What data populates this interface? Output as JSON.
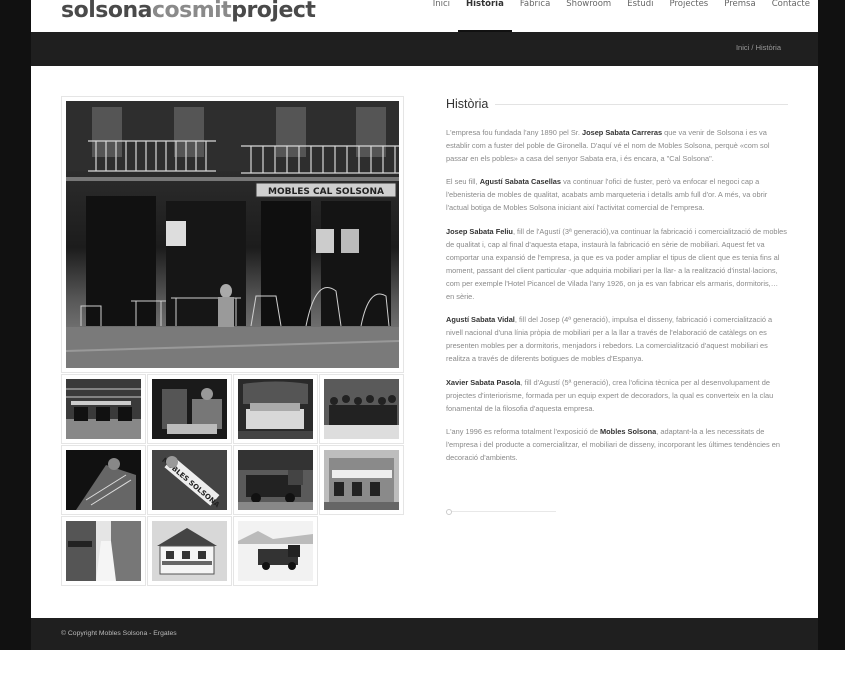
{
  "header": {
    "logo_part1": "solsona",
    "logo_part2": "cosmit",
    "logo_part3": "project",
    "nav": [
      "Inici",
      "Història",
      "Fàbrica",
      "Showroom",
      "Estudi",
      "Projectes",
      "Premsa",
      "Contacte"
    ],
    "active_nav": "Història"
  },
  "breadcrumb": {
    "home": "Inici",
    "separator": "/",
    "current": "Història"
  },
  "content": {
    "title": "Història",
    "paragraphs": [
      [
        {
          "t": "L'empresa fou fundada l'any 1890 pel Sr. "
        },
        {
          "b": "Josep Sabata Carreras"
        },
        {
          "t": " que va venir de Solsona i es va establir com a fuster del poble de Gironella. D'aquí vé el nom de Mobles Solsona, perquè «com sol passar en els pobles» a casa del senyor Sabata era, i és encara, a \"Cal Solsona\"."
        }
      ],
      [
        {
          "t": "El seu fill, "
        },
        {
          "b": "Agustí Sabata Casellas"
        },
        {
          "t": " va continuar l'ofici de fuster, però va enfocar el negoci cap a l'ebenisteria de mobles de qualitat, acabats amb marqueteria i detalls amb full d'or. A més, va obrir l'actual botiga de Mobles Solsona iniciant així l'activitat comercial de l'empresa."
        }
      ],
      [
        {
          "b": "Josep Sabata Feliu"
        },
        {
          "t": ", fill de l'Agustí (3ª generació),va continuar la fabricació i comercialització de mobles de qualitat i, cap al final d'aquesta etapa, instaurà la fabricació en sèrie de mobiliari. Aquest fet va comportar una expansió de l'empresa, ja que es va poder ampliar el tipus de client que es tenia fins al moment, passant del client particular -que adquiria mobiliari per la llar- a la realització d'instal·lacions, com per exemple l'Hotel Picancel de Vilada l'any 1926, on ja es van fabricar els armaris, dormitoris,… en sèrie."
        }
      ],
      [
        {
          "b": "Agustí Sabata Vidal"
        },
        {
          "t": ", fill del Josep (4ª generació), impulsa el disseny, fabricació i comercialització a nivell nacional d'una línia pròpia de mobiliari per a la llar a través de l'elaboració de catàlegs on es presenten mobles per a dormitoris, menjadors i rebedors. La comercialització d'aquest mobiliari es realitza a través de diferents botigues de mobles d'Espanya."
        }
      ],
      [
        {
          "b": "Xavier Sabata Pasola"
        },
        {
          "t": ", fill d'Agustí (5ª generació), crea l'oficina tècnica per al desenvolupament de projectes d'interiorisme, formada per un equip expert de decoradors, la qual es converteix en la clau fonamental de la filosofia d'aquesta empresa."
        }
      ],
      [
        {
          "t": "L'any 1996 es reforma totalment l'exposició de "
        },
        {
          "b": "Mobles Solsona"
        },
        {
          "t": ", adaptant-la a les necessitats de l'empresa i del producte a comercialitzar, el mobiliari de disseny, incorporant les últimes tendències en decoració d'ambients."
        }
      ]
    ]
  },
  "gallery": {
    "main_sign_text": "MOBLES CAL SOLSONA",
    "thumb_sign_text": "MOBLES SOLSONA",
    "thumbnails": [
      "thumb-1",
      "thumb-2",
      "thumb-3",
      "thumb-4",
      "thumb-5",
      "thumb-6",
      "thumb-7",
      "thumb-8",
      "thumb-9",
      "thumb-10",
      "thumb-11"
    ]
  },
  "footer": {
    "copyright": "© Copyright Mobles Solsona - Ergates"
  },
  "colors": {
    "dark_bar": "#1f1f1f",
    "frame": "#111111",
    "text": "#8a8a8a",
    "bold": "#333333"
  }
}
